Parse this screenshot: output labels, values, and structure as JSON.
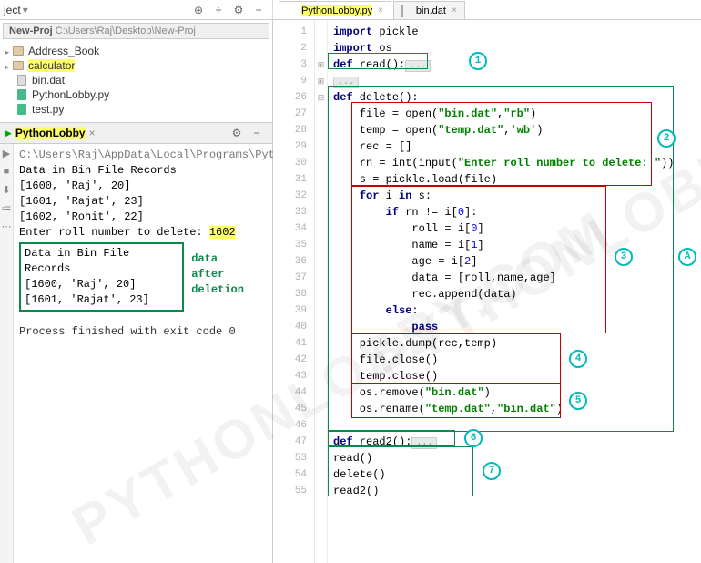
{
  "toolbar": {
    "label": "ject"
  },
  "tabs": [
    {
      "name": "PythonLobby.py",
      "active": true
    },
    {
      "name": "bin.dat",
      "active": false
    }
  ],
  "project": {
    "breadcrumb": "New-Proj  C:\\Users\\Raj\\Desktop\\New-Proj",
    "items": [
      {
        "type": "dir",
        "label": "Address_Book"
      },
      {
        "type": "dir",
        "label": "calculator",
        "hl": true
      },
      {
        "type": "file",
        "label": "bin.dat",
        "kind": "dat"
      },
      {
        "type": "file",
        "label": "PythonLobby.py",
        "kind": "py"
      },
      {
        "type": "file",
        "label": "test.py",
        "kind": "py"
      }
    ]
  },
  "run": {
    "title": "PythonLobby",
    "lines": {
      "path": "C:\\Users\\Raj\\AppData\\Local\\Programs\\Pyth",
      "l1": "Data in Bin File Records",
      "l2": "[1600, 'Raj', 20]",
      "l3": "[1601, 'Rajat', 23]",
      "l4": "[1602, 'Rohit', 22]",
      "prompt": "Enter roll number to delete: ",
      "input": "1602",
      "box1": "Data in Bin File Records",
      "box2": "[1600, 'Raj', 20]",
      "box3": "[1601, 'Rajat', 23]",
      "label1": "data",
      "label2": "after deletion",
      "exit": "Process finished with exit code 0"
    }
  },
  "editor": {
    "line_numbers": [
      "1",
      "2",
      "3",
      "9",
      "26",
      "27",
      "28",
      "29",
      "30",
      "31",
      "32",
      "33",
      "34",
      "35",
      "36",
      "37",
      "38",
      "39",
      "40",
      "41",
      "42",
      "43",
      "44",
      "45",
      "46",
      "47",
      "53",
      "54",
      "55"
    ],
    "code": {
      "l1_a": "import",
      "l1_b": " pickle",
      "l2_a": "import",
      "l2_b": " os",
      "l3_a": "def",
      "l3_b": " read():",
      "l3_c": "...",
      "l4": "...",
      "l5_a": "def",
      "l5_b": " delete():",
      "l6_a": "    file = open(",
      "l6_s1": "\"bin.dat\"",
      "l6_b": ",",
      "l6_s2": "\"rb\"",
      "l6_c": ")",
      "l7_a": "    temp = open(",
      "l7_s1": "\"temp.dat\"",
      "l7_b": ",",
      "l7_s2": "'wb'",
      "l7_c": ")",
      "l8": "    rec = []",
      "l9_a": "    rn = int(input(",
      "l9_s": "\"Enter roll number to delete: \"",
      "l9_b": "))",
      "l10": "    s = pickle.load(file)",
      "l11_a": "    for",
      "l11_b": " i ",
      "l11_c": "in",
      "l11_d": " s:",
      "l12_a": "        if",
      "l12_b": " rn != i[",
      "l12_n": "0",
      "l12_c": "]:",
      "l13_a": "            roll = i[",
      "l13_n": "0",
      "l13_b": "]",
      "l14_a": "            name = i[",
      "l14_n": "1",
      "l14_b": "]",
      "l15_a": "            age = i[",
      "l15_n": "2",
      "l15_b": "]",
      "l16": "            data = [roll,name,age]",
      "l17": "            rec.append(data)",
      "l18_a": "        else",
      "l18_b": ":",
      "l19_a": "            pass",
      "l20": "    pickle.dump(rec,temp)",
      "l21": "    file.close()",
      "l22": "    temp.close()",
      "l23_a": "    os.remove(",
      "l23_s": "\"bin.dat\"",
      "l23_b": ")",
      "l24_a": "    os.rename(",
      "l24_s1": "\"temp.dat\"",
      "l24_b": ",",
      "l24_s2": "\"bin.dat\"",
      "l24_c": ")",
      "l26_a": "def",
      "l26_b": " read2():",
      "l26_c": "...",
      "l27": "read()",
      "l28": "delete()",
      "l29": "read2()"
    }
  },
  "bubbles": {
    "b1": "1",
    "b2": "2",
    "b3": "3",
    "b4": "4",
    "b5": "5",
    "b6": "6",
    "b7": "7",
    "bA": "A"
  },
  "watermark": "PYTHONLOBBY.COM"
}
